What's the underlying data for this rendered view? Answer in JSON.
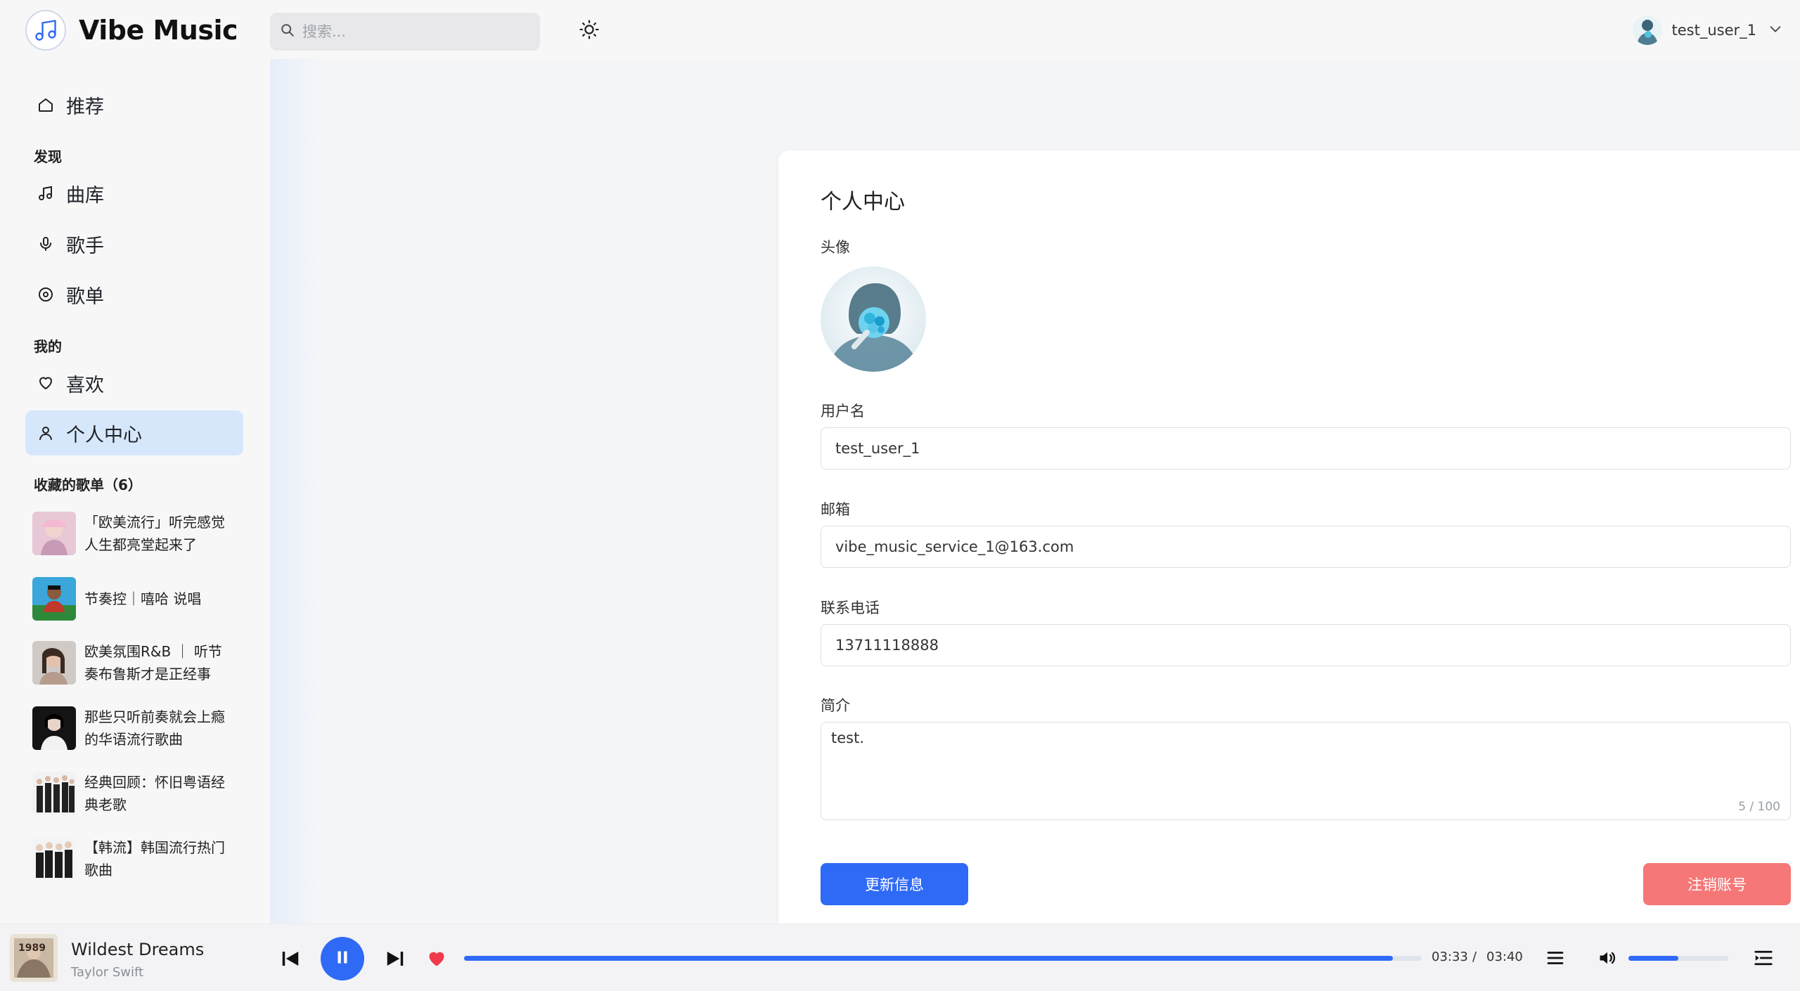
{
  "app": {
    "name": "Vibe Music"
  },
  "search": {
    "placeholder": "搜索..."
  },
  "user": {
    "name": "test_user_1"
  },
  "sidebar": {
    "recommend": "推荐",
    "discover_title": "发现",
    "library": "曲库",
    "artists": "歌手",
    "playlists": "歌单",
    "mine_title": "我的",
    "likes": "喜欢",
    "profile": "个人中心",
    "collected_title": "收藏的歌单（6）",
    "collected": [
      {
        "line1": "「欧美流行」听完感觉",
        "line2": "人生都亮堂起来了"
      },
      {
        "line1": "节奏控｜嘻哈 说唱",
        "line2": ""
      },
      {
        "line1": "欧美氛围R&B ｜ 听节",
        "line2": "奏布鲁斯才是正经事"
      },
      {
        "line1": "那些只听前奏就会上瘾",
        "line2": "的华语流行歌曲"
      },
      {
        "line1": "经典回顾：怀旧粤语经",
        "line2": "典老歌"
      },
      {
        "line1": "【韩流】韩国流行热门",
        "line2": "歌曲"
      }
    ]
  },
  "profile": {
    "title": "个人中心",
    "avatar_label": "头像",
    "username_label": "用户名",
    "username_value": "test_user_1",
    "email_label": "邮箱",
    "email_value": "vibe_music_service_1@163.com",
    "phone_label": "联系电话",
    "phone_value": "13711118888",
    "bio_label": "简介",
    "bio_value": "test.",
    "bio_counter": "5 / 100",
    "update_button": "更新信息",
    "delete_button": "注销账号"
  },
  "player": {
    "song_title": "Wildest Dreams",
    "artist": "Taylor Swift",
    "current_time": "03:33",
    "separator": "/",
    "total_time": "03:40",
    "progress": 0.97,
    "volume": 0.5,
    "liked": true
  },
  "colors": {
    "accent": "#2f6af6",
    "danger": "#f57777",
    "active_nav": "#d6e7fb",
    "heart": "#f03a4a"
  },
  "icons": [
    "music-note-icon",
    "search-icon",
    "sun-icon",
    "chevron-down-icon",
    "home-icon",
    "music-icon",
    "mic-icon",
    "disc-icon",
    "heart-icon",
    "user-icon",
    "prev-icon",
    "pause-icon",
    "next-icon",
    "playlist-icon",
    "volume-icon",
    "queue-icon"
  ]
}
